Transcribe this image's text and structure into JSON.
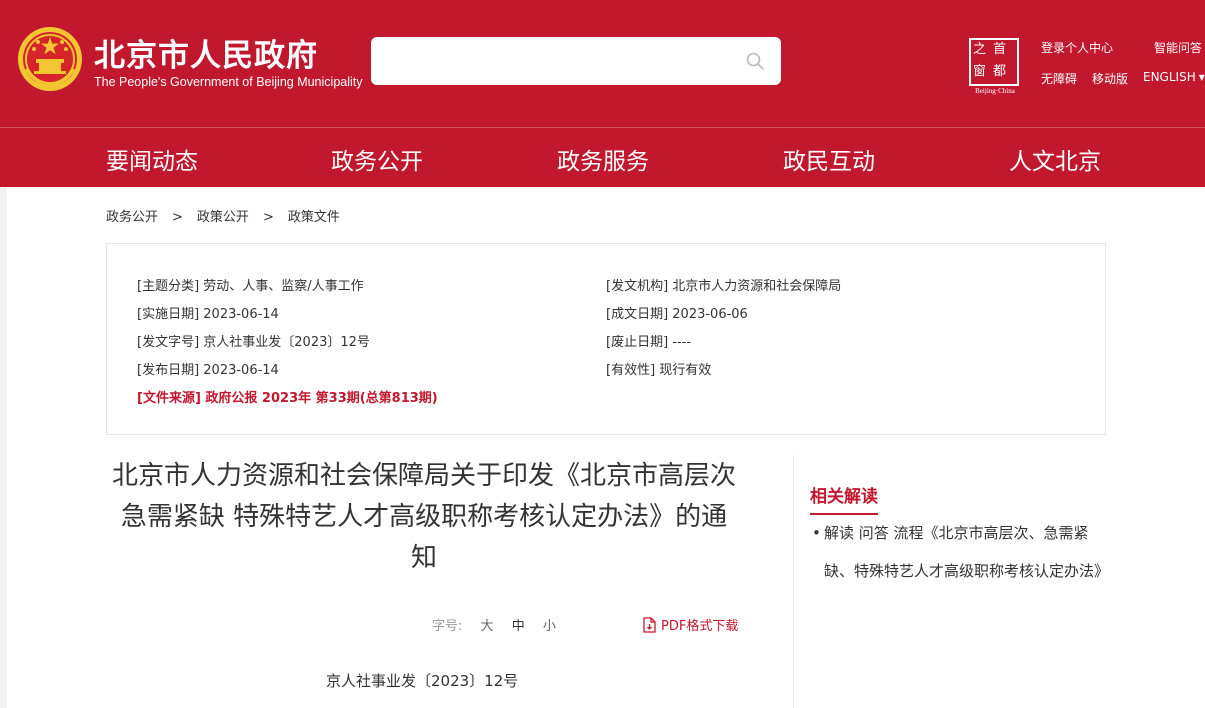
{
  "header": {
    "title": "北京市人民政府",
    "subtitle": "The People's Government of Beijing Municipality",
    "search": {
      "value": "",
      "placeholder": ""
    },
    "capital_logo": {
      "chars": [
        "之",
        "首",
        "窗",
        "都"
      ],
      "caption": "Beijing·China"
    },
    "links": {
      "login": "登录个人中心",
      "ai_qa": "智能问答",
      "accessibility": "无障碍",
      "mobile": "移动版",
      "english": "ENGLISH"
    }
  },
  "nav": {
    "items": [
      "要闻动态",
      "政务公开",
      "政务服务",
      "政民互动",
      "人文北京"
    ]
  },
  "breadcrumb": [
    "政务公开",
    "政策公开",
    "政策文件"
  ],
  "breadcrumb_sep": ">",
  "meta": {
    "subject": "[主题分类] 劳动、人事、监察/人事工作",
    "issuer": "[发文机构] 北京市人力资源和社会保障局",
    "effective_date": "[实施日期] 2023-06-14",
    "written_date": "[成文日期] 2023-06-06",
    "doc_no": "[发文字号] 京人社事业发〔2023〕12号",
    "abolish_date": "[废止日期] ----",
    "publish_date": "[发布日期] 2023-06-14",
    "validity": "[有效性] 现行有效",
    "source": "[文件来源] 政府公报 2023年 第33期(总第813期)"
  },
  "document": {
    "title": "北京市人力资源和社会保障局关于印发《北京市高层次 急需紧缺 特殊特艺人才高级职称考核认定办法》的通知",
    "font_size_label": "字号:",
    "font_size_options": [
      "大",
      "中",
      "小"
    ],
    "pdf_download": "PDF格式下载",
    "doc_number": "京人社事业发〔2023〕12号"
  },
  "related": {
    "title": "相关解读",
    "bullet": "•",
    "items": [
      "解读 问答 流程《北京市高层次、急需紧缺、特殊特艺人才高级职称考核认定办法》"
    ]
  },
  "colors": {
    "brand_red": "#c2182d",
    "emblem_gold": "#f2c531"
  }
}
